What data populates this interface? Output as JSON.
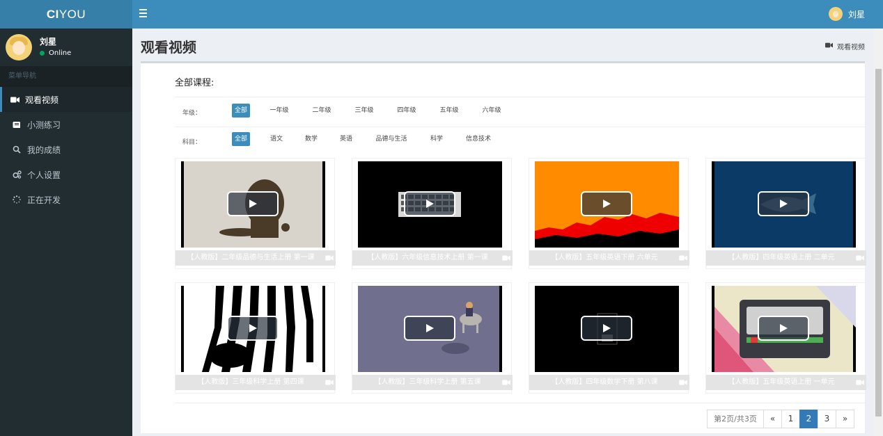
{
  "brand": {
    "bold": "CI",
    "rest": "YOU"
  },
  "user": {
    "name": "刘星",
    "status": "Online"
  },
  "sidebar": {
    "header": "菜单导航",
    "items": [
      {
        "label": "观看视频",
        "icon": "video-icon",
        "active": true
      },
      {
        "label": "小测练习",
        "icon": "book-icon",
        "active": false
      },
      {
        "label": "我的成绩",
        "icon": "search-icon",
        "active": false
      },
      {
        "label": "个人设置",
        "icon": "gears-icon",
        "active": false
      },
      {
        "label": "正在开发",
        "icon": "spinner-icon",
        "active": false
      }
    ]
  },
  "page": {
    "title": "观看视频",
    "breadcrumb": "观看视频"
  },
  "box": {
    "title": "全部课程:",
    "grade_label": "年级：",
    "grades": [
      "全部",
      "一年级",
      "二年级",
      "三年级",
      "四年级",
      "五年级",
      "六年级"
    ],
    "subject_label": "科目：",
    "subjects": [
      "全部",
      "语文",
      "数学",
      "英语",
      "品德与生活",
      "科学",
      "信息技术"
    ]
  },
  "videos": [
    {
      "title": "【人教版】二年级品德与生活上册 第一课",
      "thumb": "lion-silhouette"
    },
    {
      "title": "【人教版】六年级信息技术上册 第一课",
      "thumb": "keyboard-black"
    },
    {
      "title": "【人教版】五年级英语下册 六单元",
      "thumb": "orange-sunset"
    },
    {
      "title": "【人教版】四年级英语上册 二单元",
      "thumb": "blue-shark"
    },
    {
      "title": "【人教版】三年级科学上册 第四课",
      "thumb": "zebra-stripes"
    },
    {
      "title": "【人教版】三年级科学上册 第五课",
      "thumb": "purple-rider"
    },
    {
      "title": "【人教版】四年级数学下册 第八课",
      "thumb": "black-grid"
    },
    {
      "title": "【人教版】五年级英语上册 一单元",
      "thumb": "cassette-tape"
    }
  ],
  "pagination": {
    "info": "第2页/共3页",
    "prev": "«",
    "pages": [
      "1",
      "2",
      "3"
    ],
    "current": "2",
    "next": "»"
  },
  "colors": {
    "header": "#3c8dbc",
    "logo_bg": "#367fa9",
    "sidebar": "#222d32",
    "active_chip": "#3c8dbc",
    "page_active": "#337ab7"
  }
}
